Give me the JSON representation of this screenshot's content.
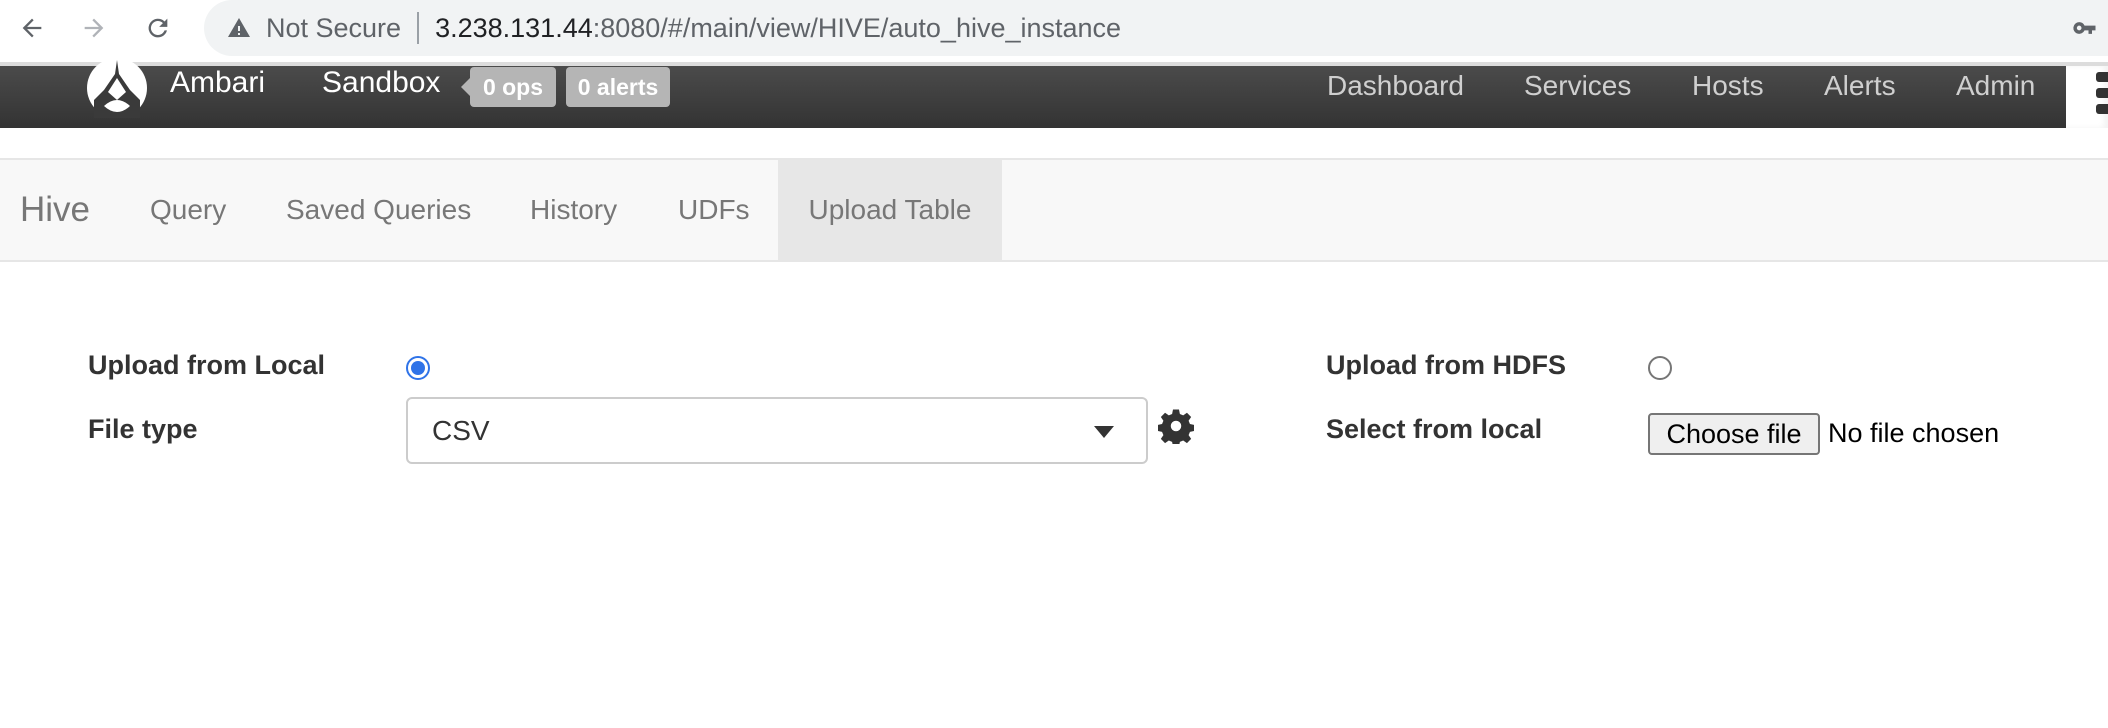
{
  "browser": {
    "security_label": "Not Secure",
    "url_host": "3.238.131.44",
    "url_rest": ":8080/#/main/view/HIVE/auto_hive_instance",
    "icons": [
      "back-arrow-icon",
      "forward-arrow-icon",
      "reload-icon",
      "warning-triangle-icon",
      "key-icon"
    ]
  },
  "header": {
    "brand": "Ambari",
    "cluster_name": "Sandbox",
    "ops_badge": "0 ops",
    "alerts_badge": "0 alerts",
    "nav": [
      "Dashboard",
      "Services",
      "Hosts",
      "Alerts",
      "Admin"
    ],
    "colors": {
      "bar": "#3f3f3f",
      "badge": "#b5b5b5"
    }
  },
  "subnav": {
    "title": "Hive",
    "tabs": [
      {
        "label": "Query",
        "active": false
      },
      {
        "label": "Saved Queries",
        "active": false
      },
      {
        "label": "History",
        "active": false
      },
      {
        "label": "UDFs",
        "active": false
      },
      {
        "label": "Upload Table",
        "active": true
      }
    ]
  },
  "form": {
    "upload_local_label": "Upload from Local",
    "upload_local_selected": true,
    "file_type_label": "File type",
    "file_type_value": "CSV",
    "upload_hdfs_label": "Upload from HDFS",
    "upload_hdfs_selected": false,
    "select_local_label": "Select from local",
    "choose_file_label": "Choose file",
    "no_file_text": "No file chosen",
    "accent_color": "#2f73e8"
  }
}
